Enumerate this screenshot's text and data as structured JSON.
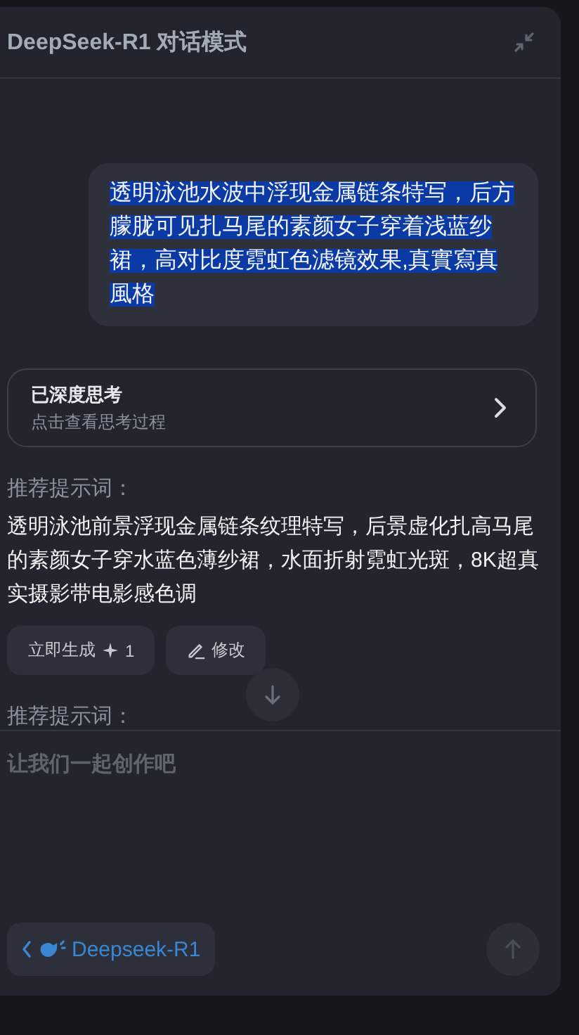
{
  "header": {
    "title": "DeepSeek-R1 对话模式"
  },
  "user_message": {
    "text": "透明泳池水波中浮现金属链条特写，后方朦胧可见扎马尾的素颜女子穿着浅蓝纱裙，高对比度霓虹色滤镜效果,真實寫真風格",
    "highlighted": true
  },
  "thinking_card": {
    "title": "已深度思考",
    "subtitle": "点击查看思考过程"
  },
  "suggestions": [
    {
      "label": "推荐提示词：",
      "text": "透明泳池前景浮现金属链条纹理特写，后景虚化扎高马尾的素颜女子穿水蓝色薄纱裙，水面折射霓虹光斑，8K超真实摄影带电影感色调",
      "generate_button": "立即生成",
      "cost": "1",
      "edit_button": "修改"
    },
    {
      "label": "推荐提示词："
    }
  ],
  "input": {
    "placeholder": "让我们一起创作吧"
  },
  "model_button": {
    "label": "Deepseek-R1"
  }
}
